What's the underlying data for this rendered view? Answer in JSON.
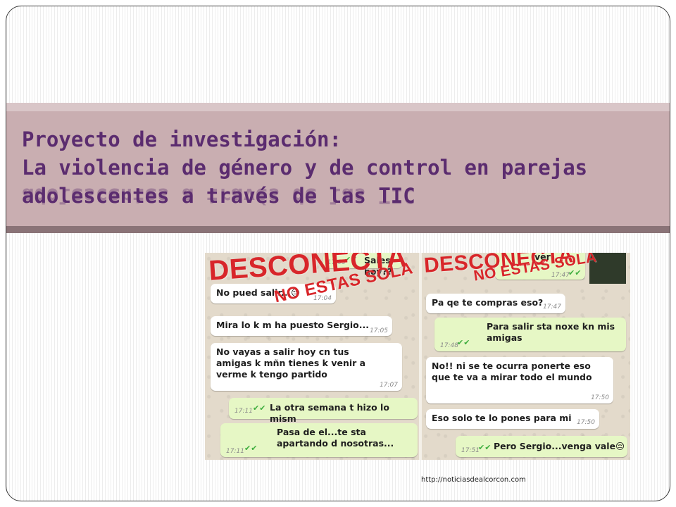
{
  "slide": {
    "title_lines": [
      "Proyecto de investigación:",
      "La violencia de género y de control en parejas",
      "adolescentes a través de las TIC"
    ],
    "source_url": "http://noticiasdealcorcon.com"
  },
  "image": {
    "stamp_main": "DESCONECTA",
    "stamp_sub": "NO ESTAS SOLA",
    "left_chat": [
      {
        "text": "Sales hoy??",
        "time": "17:03",
        "dir": "out"
      },
      {
        "text": "No pued salir...😔",
        "time": "17:04",
        "dir": "in"
      },
      {
        "text": "Mira lo k m ha puesto Sergio...",
        "time": "17:05",
        "dir": "in"
      },
      {
        "text": "No vayas a salir hoy cn tus amigas k mñn tienes k venir a verme k tengo partido",
        "time": "17:07",
        "dir": "in"
      },
      {
        "text": "La otra semana t hizo lo mism",
        "time": "17:11",
        "dir": "out"
      },
      {
        "text": "Pasa de el...te sta apartando d nosotras...",
        "time": "17:11",
        "dir": "out"
      }
    ],
    "right_chat": [
      {
        "text": "ver",
        "time": "17:47",
        "dir": "out"
      },
      {
        "text": "Pa qe te compras eso?",
        "time": "17:47",
        "dir": "in"
      },
      {
        "text": "Para salir sta noxe kn mis amigas",
        "time": "17:48",
        "dir": "out"
      },
      {
        "text": "No!! ni se te ocurra ponerte eso que te va a mirar todo el mundo",
        "time": "17:50",
        "dir": "in"
      },
      {
        "text": "Eso solo te lo pones para mi",
        "time": "17:50",
        "dir": "in"
      },
      {
        "text": "Pero Sergio...venga vale😔",
        "time": "17:51",
        "dir": "out"
      }
    ]
  },
  "colors": {
    "title_text": "#5b2c6f",
    "title_band": "#c9aeb1",
    "stamp_red": "#d8262a",
    "bubble_out": "#e6f7c5",
    "bubble_in": "#ffffff"
  }
}
